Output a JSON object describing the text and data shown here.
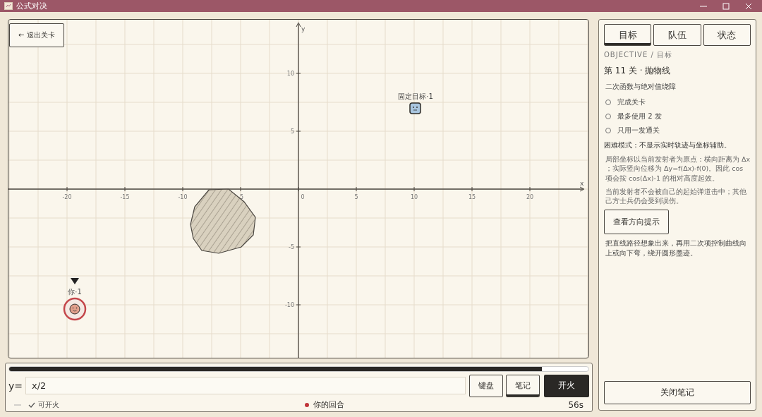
{
  "window": {
    "title": "公式对决"
  },
  "board": {
    "exit_button": "← 退出关卡",
    "x_axis_label": "x",
    "y_axis_label": "y",
    "x_ticks": [
      "-20",
      "-15",
      "-10",
      "-5",
      "0",
      "5",
      "10",
      "15",
      "20"
    ],
    "y_ticks": [
      "10",
      "5",
      "-5",
      "-10"
    ],
    "target": {
      "label": "固定目标·1"
    },
    "player": {
      "label": "你·1",
      "active": true
    }
  },
  "controls": {
    "timer": {
      "level": 0.92
    },
    "prefix": "y=",
    "formula": "x/2",
    "buttons": [
      {
        "label": "键盘",
        "kind": "plain",
        "active": false
      },
      {
        "label": "笔记",
        "kind": "plain",
        "active": true
      },
      {
        "label": "开火",
        "kind": "primary",
        "active": false
      }
    ],
    "ready": {
      "label": "可开火",
      "ok": true
    },
    "turn": {
      "label": "你的回合",
      "color": "#c0343a"
    },
    "time_left": "56s"
  },
  "panel": {
    "tabs": [
      {
        "label": "目标",
        "selected": true
      },
      {
        "label": "队伍",
        "selected": false
      },
      {
        "label": "状态",
        "selected": false
      }
    ],
    "section_label": "OBJECTIVE / 目标",
    "level_title": "第 11 关 · 抛物线",
    "subtitle": "二次函数与绝对值绕障",
    "objectives": [
      {
        "label": "完成关卡",
        "checked": false
      },
      {
        "label": "最多使用 2 发",
        "checked": false
      },
      {
        "label": "只用一发通关",
        "checked": false
      }
    ],
    "hard_mode": "困难模式：不显示实时轨迹与坐标辅助。",
    "notes": [
      "局部坐标以当前发射者为原点：横向距离为 Δx ；实际竖向位移为 Δy=f(Δx)-f(0)。因此 cos 项会按 cos(Δx)-1 的相对高度起效。",
      "当前发射者不会被自己的起始弹道击中；其他己方士兵仍会受到误伤。"
    ],
    "hint_button": "查看方向提示",
    "hint": "把直线路径想象出来，再用二次项控制曲线向上或向下弯，绕开圆形墨迹。",
    "close_button": "关闭笔记"
  }
}
